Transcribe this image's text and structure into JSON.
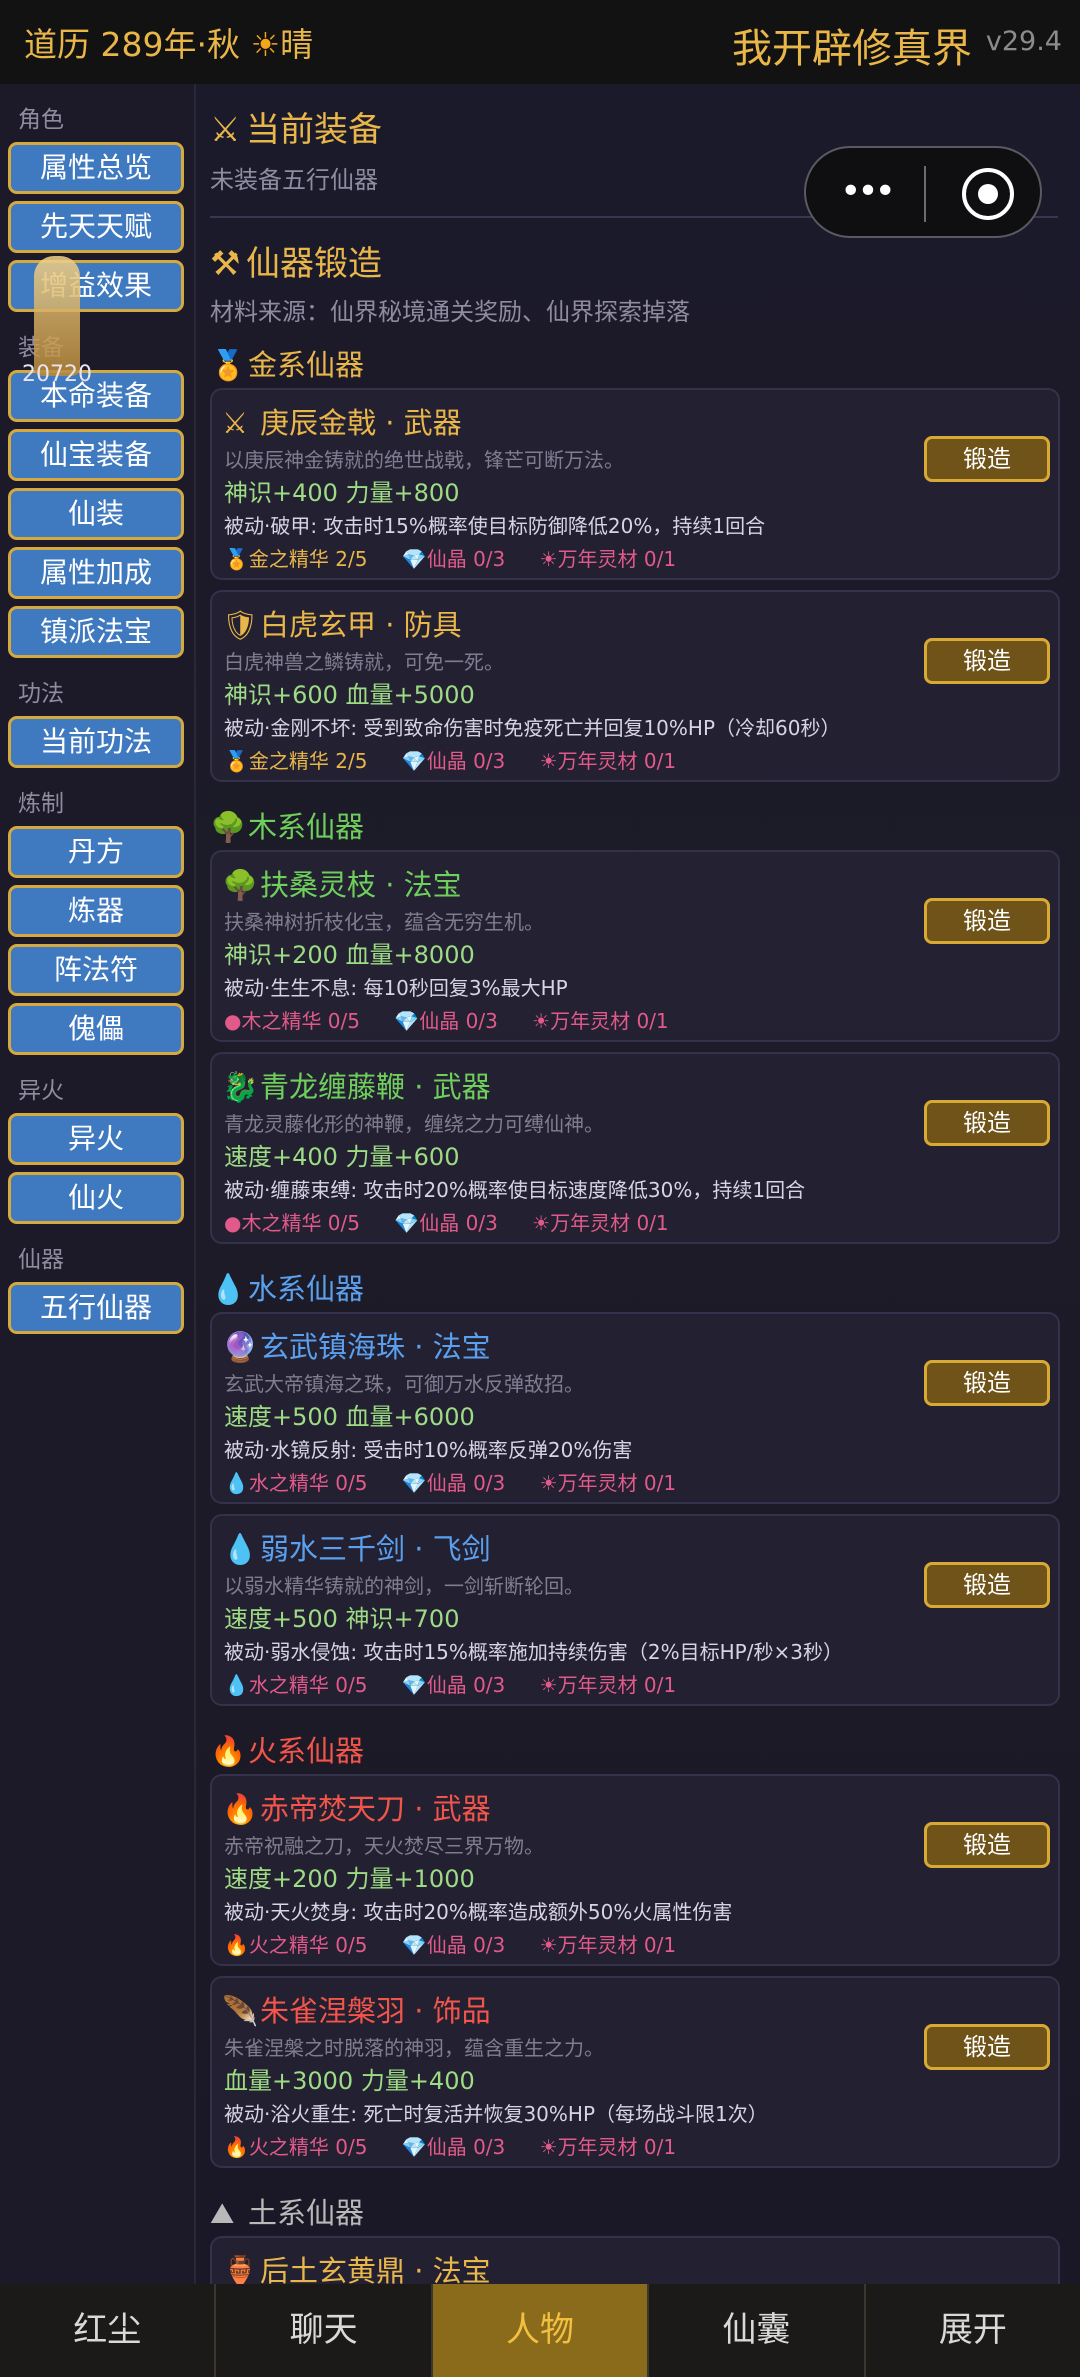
{
  "topbar": {
    "calendar_prefix": "道历 289年·秋",
    "sun_icon": "☀",
    "weather": "晴",
    "title": "我开辟修真界",
    "version": "v29.4"
  },
  "sidebar": {
    "sections": [
      {
        "title": "角色",
        "items": [
          "属性总览",
          "先天天赋",
          "增益效果"
        ]
      },
      {
        "title": "装备",
        "items": [
          "本命装备",
          "仙宝装备",
          "仙装",
          "属性加成",
          "镇派法宝"
        ]
      },
      {
        "title": "功法",
        "items": [
          "当前功法"
        ]
      },
      {
        "title": "炼制",
        "items": [
          "丹方",
          "炼器",
          "阵法符",
          "傀儡"
        ]
      },
      {
        "title": "异火",
        "items": [
          "异火",
          "仙火"
        ]
      },
      {
        "title": "仙器",
        "items": [
          "五行仙器"
        ]
      }
    ],
    "avatar_number": "20720"
  },
  "main": {
    "equip_title": "当前装备",
    "equip_empty": "未装备五行仙器",
    "forge_title": "仙器锻造",
    "source": "材料来源：仙界秘境通关奖励、仙界探索掉落",
    "forge_label": "锻造",
    "categories": [
      {
        "label": "金系仙器",
        "icon": "medal-icon",
        "color": "#e9b64a"
      },
      {
        "label": "木系仙器",
        "icon": "tree-icon",
        "color": "#6fcf5c"
      },
      {
        "label": "水系仙器",
        "icon": "droplet-icon",
        "color": "#5aa0ee"
      },
      {
        "label": "火系仙器",
        "icon": "fire-icon",
        "color": "#f2554a"
      },
      {
        "label": "土系仙器",
        "icon": "earth-icon",
        "color": "#b9b9b9"
      }
    ],
    "items": [
      {
        "name": "庚辰金戟 · 武器",
        "desc": "以庚辰神金铸就的绝世战戟，锋芒可断万法。",
        "stats": "神识+400  力量+800",
        "passive": "被动·破甲: 攻击时15%概率使目标防御降低20%，持续1回合",
        "essence": "金之精华 2/5",
        "crystal": "仙晶 0/3",
        "herb": "万年灵材 0/1",
        "color": "#e9b64a"
      },
      {
        "name": "白虎玄甲 · 防具",
        "desc": "白虎神兽之鳞铸就，可免一死。",
        "stats": "神识+600  血量+5000",
        "passive": "被动·金刚不坏: 受到致命伤害时免疫死亡并回复10%HP（冷却60秒）",
        "essence": "金之精华 2/5",
        "crystal": "仙晶 0/3",
        "herb": "万年灵材 0/1",
        "color": "#e9b64a"
      },
      {
        "name": "扶桑灵枝 · 法宝",
        "desc": "扶桑神树折枝化宝，蕴含无穷生机。",
        "stats": "神识+200  血量+8000",
        "passive": "被动·生生不息: 每10秒回复3%最大HP",
        "essence": "木之精华 0/5",
        "crystal": "仙晶 0/3",
        "herb": "万年灵材 0/1",
        "color": "#6fcf5c"
      },
      {
        "name": "青龙缠藤鞭 · 武器",
        "desc": "青龙灵藤化形的神鞭，缠绕之力可缚仙神。",
        "stats": "速度+400  力量+600",
        "passive": "被动·缠藤束缚: 攻击时20%概率使目标速度降低30%，持续1回合",
        "essence": "木之精华 0/5",
        "crystal": "仙晶 0/3",
        "herb": "万年灵材 0/1",
        "color": "#6fcf5c"
      },
      {
        "name": "玄武镇海珠 · 法宝",
        "desc": "玄武大帝镇海之珠，可御万水反弹敌招。",
        "stats": "速度+500  血量+6000",
        "passive": "被动·水镜反射: 受击时10%概率反弹20%伤害",
        "essence": "水之精华 0/5",
        "crystal": "仙晶 0/3",
        "herb": "万年灵材 0/1",
        "color": "#5aa0ee"
      },
      {
        "name": "弱水三千剑 · 飞剑",
        "desc": "以弱水精华铸就的神剑，一剑斩断轮回。",
        "stats": "速度+500  神识+700",
        "passive": "被动·弱水侵蚀: 攻击时15%概率施加持续伤害（2%目标HP/秒×3秒）",
        "essence": "水之精华 0/5",
        "crystal": "仙晶 0/3",
        "herb": "万年灵材 0/1",
        "color": "#5aa0ee"
      },
      {
        "name": "赤帝焚天刀 · 武器",
        "desc": "赤帝祝融之刀，天火焚尽三界万物。",
        "stats": "速度+200  力量+1000",
        "passive": "被动·天火焚身: 攻击时20%概率造成额外50%火属性伤害",
        "essence": "火之精华 0/5",
        "crystal": "仙晶 0/3",
        "herb": "万年灵材 0/1",
        "color": "#f2554a"
      },
      {
        "name": "朱雀涅槃羽 · 饰品",
        "desc": "朱雀涅槃之时脱落的神羽，蕴含重生之力。",
        "stats": "血量+3000  力量+400",
        "passive": "被动·浴火重生: 死亡时复活并恢复30%HP（每场战斗限1次）",
        "essence": "火之精华 0/5",
        "crystal": "仙晶 0/3",
        "herb": "万年灵材 0/1",
        "color": "#f2554a"
      },
      {
        "name": "后土玄黄鼎 · 法宝",
        "color": "#e9b64a"
      }
    ]
  },
  "navbar": {
    "items": [
      "红尘",
      "聊天",
      "人物",
      "仙囊",
      "展开"
    ],
    "active": "人物"
  }
}
